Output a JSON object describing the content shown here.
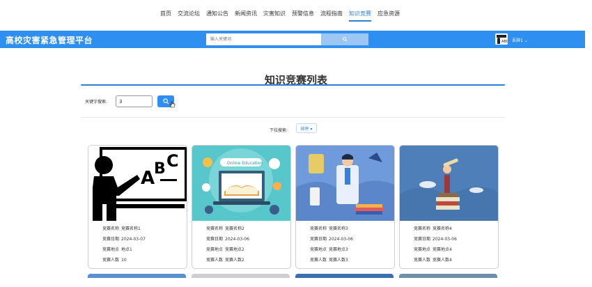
{
  "nav": {
    "items": [
      {
        "label": "首页",
        "active": false
      },
      {
        "label": "交流论坛",
        "active": false
      },
      {
        "label": "通知公告",
        "active": false
      },
      {
        "label": "新闻资讯",
        "active": false
      },
      {
        "label": "灾害知识",
        "active": false
      },
      {
        "label": "预警信息",
        "active": false
      },
      {
        "label": "流程指南",
        "active": false
      },
      {
        "label": "知识竞赛",
        "active": true
      },
      {
        "label": "应急资源",
        "active": false
      }
    ]
  },
  "header": {
    "brand": "高校灾害紧急管理平台",
    "search_placeholder": "输入关键词",
    "user_name": "吾辞1 ⌄"
  },
  "page": {
    "title": "知识竞赛列表",
    "keyword_label": "关键字搜索:",
    "keyword_value": "3",
    "sort_label": "下拉搜索:",
    "sort_value": "排序 ▾"
  },
  "colors": {
    "accent": "#2f8ff0"
  },
  "cards": [
    {
      "image": "teacher-blackboard-image",
      "name_key": "竞赛名称",
      "name": "竞赛名称1",
      "date_key": "竞赛日期",
      "date": "2024-03-07",
      "place_key": "竞赛地点",
      "place": "地点1",
      "count_key": "竞赛人数",
      "count": "10"
    },
    {
      "image": "online-education-image",
      "name_key": "竞赛名称",
      "name": "竞赛名称2",
      "date_key": "竞赛日期",
      "date": "2024-03-06",
      "place_key": "竞赛地点",
      "place": "竞赛地点2",
      "count_key": "竞赛人数",
      "count": "竞赛人数2"
    },
    {
      "image": "scientist-image",
      "name_key": "竞赛名称",
      "name": "竞赛名称3",
      "date_key": "竞赛日期",
      "date": "2024-03-06",
      "place_key": "竞赛地点",
      "place": "竞赛地点3",
      "count_key": "竞赛人数",
      "count": "竞赛人数3"
    },
    {
      "image": "telescope-books-image",
      "name_key": "竞赛名称",
      "name": "竞赛名称4",
      "date_key": "竞赛日期",
      "date": "2024-03-06",
      "place_key": "竞赛地点",
      "place": "竞赛地点4",
      "count_key": "竞赛人数",
      "count": "竞赛人数4"
    }
  ]
}
